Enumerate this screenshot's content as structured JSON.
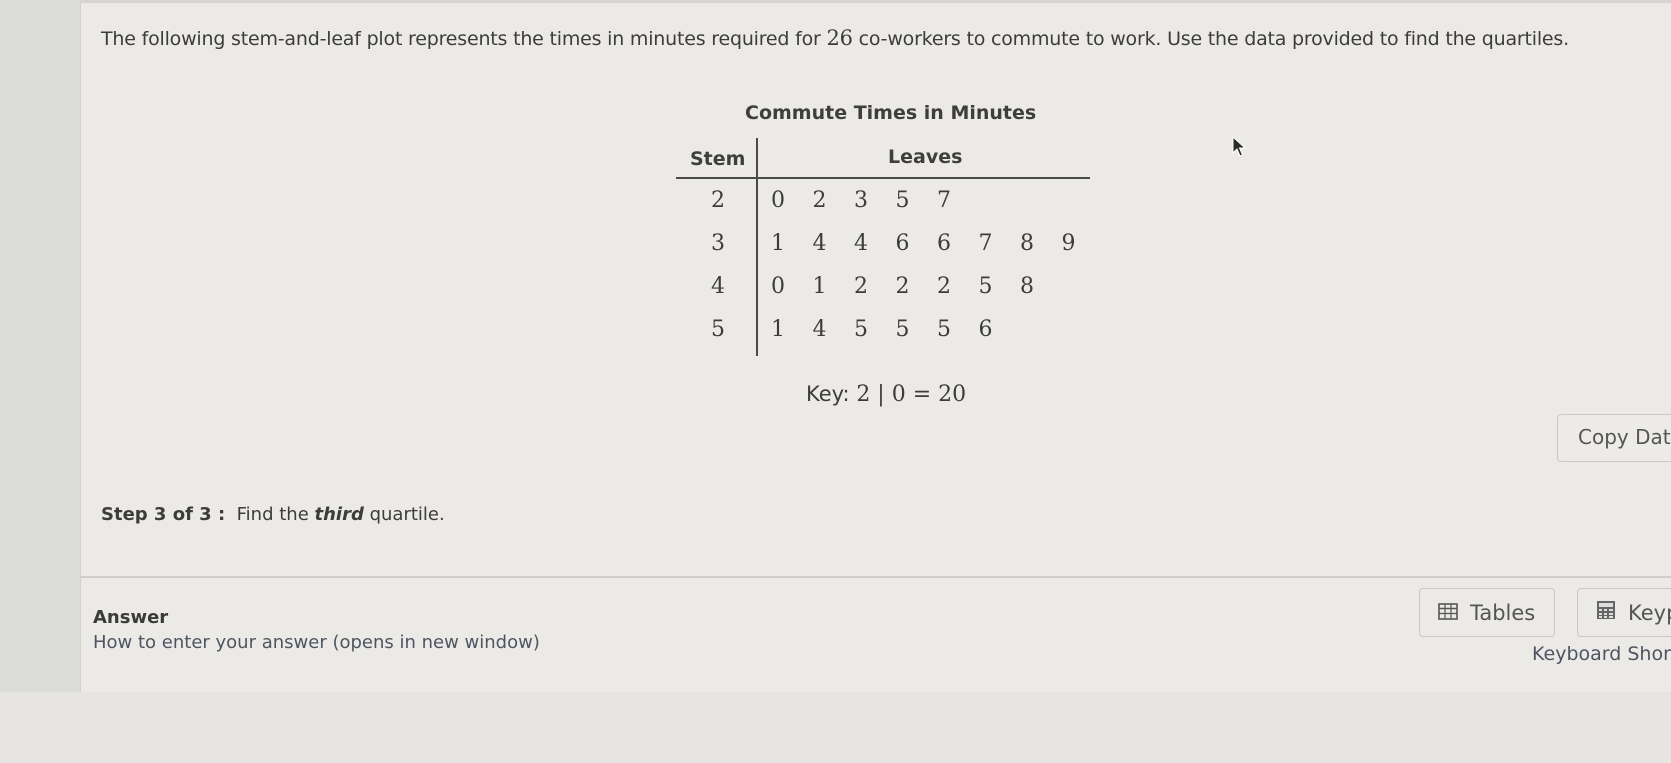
{
  "question": {
    "prefix": "The following stem-and-leaf plot represents the times in minutes required for ",
    "count": "26",
    "suffix": " co-workers to commute to work. Use the data provided to find the quartiles."
  },
  "plot": {
    "title": "Commute Times in Minutes",
    "stem_header": "Stem",
    "leaves_header": "Leaves",
    "rows": [
      {
        "stem": "2",
        "leaves": [
          "0",
          "2",
          "3",
          "5",
          "7"
        ]
      },
      {
        "stem": "3",
        "leaves": [
          "1",
          "4",
          "4",
          "6",
          "6",
          "7",
          "8",
          "9"
        ]
      },
      {
        "stem": "4",
        "leaves": [
          "0",
          "1",
          "2",
          "2",
          "2",
          "5",
          "8"
        ]
      },
      {
        "stem": "5",
        "leaves": [
          "1",
          "4",
          "5",
          "5",
          "5",
          "6"
        ]
      }
    ],
    "key_label": "Key:",
    "key_expression": "2 | 0 = 20"
  },
  "chart_data": {
    "type": "table",
    "title": "Commute Times in Minutes",
    "columns": [
      "Stem",
      "Leaves"
    ],
    "rows": [
      {
        "stem": 2,
        "leaves": [
          0,
          2,
          3,
          5,
          7
        ]
      },
      {
        "stem": 3,
        "leaves": [
          1,
          4,
          4,
          6,
          6,
          7,
          8,
          9
        ]
      },
      {
        "stem": 4,
        "leaves": [
          0,
          1,
          2,
          2,
          2,
          5,
          8
        ]
      },
      {
        "stem": 5,
        "leaves": [
          1,
          4,
          5,
          5,
          5,
          6
        ]
      }
    ],
    "key": "2|0 = 20",
    "values": [
      20,
      22,
      23,
      25,
      27,
      31,
      34,
      34,
      36,
      36,
      37,
      38,
      39,
      40,
      41,
      42,
      42,
      42,
      45,
      48,
      51,
      54,
      55,
      55,
      55,
      56
    ]
  },
  "copy_data_label": "Copy Data",
  "step": {
    "label": "Step 3 of 3 :",
    "text_before": "Find the ",
    "emphasis": "third",
    "text_after": " quartile."
  },
  "answer": {
    "label": "Answer",
    "help_link": "How to enter your answer (opens in new window)"
  },
  "tools": {
    "tables_label": "Tables",
    "keypad_label": "Keypad",
    "keyboard_shortcuts_label": "Keyboard Shortcuts"
  }
}
